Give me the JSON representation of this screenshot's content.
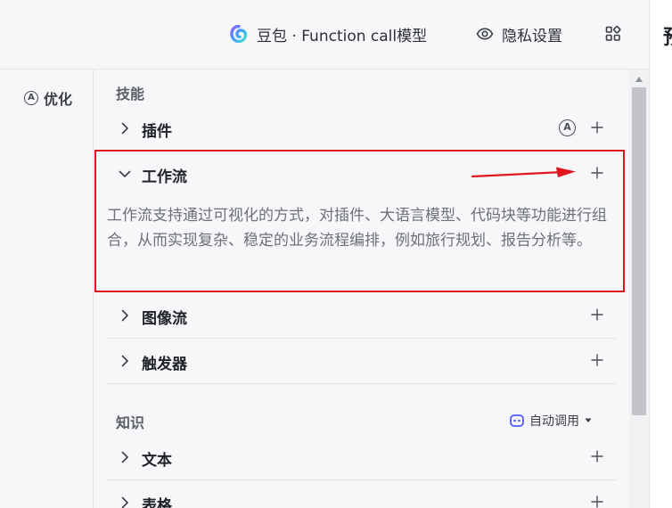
{
  "topbar": {
    "model_label": "豆包 · Function call模型",
    "privacy_label": "隐私设置",
    "right_edge_char": "预"
  },
  "leftcol": {
    "optimize_badge": "A",
    "optimize_label": "优化"
  },
  "skills": {
    "section_title": "技能",
    "items": [
      {
        "label": "插件",
        "badge": "A",
        "expanded": false
      },
      {
        "label": "工作流",
        "expanded": true,
        "description": "工作流支持通过可视化的方式，对插件、大语言模型、代码块等功能进行组合，从而实现复杂、稳定的业务流程编排，例如旅行规划、报告分析等。"
      },
      {
        "label": "图像流",
        "expanded": false
      },
      {
        "label": "触发器",
        "expanded": false
      }
    ]
  },
  "knowledge": {
    "section_title": "知识",
    "auto_call_label": "自动调用",
    "items": [
      {
        "label": "文本",
        "expanded": false
      },
      {
        "label": "表格",
        "expanded": false
      }
    ]
  },
  "colors": {
    "highlight_border": "#e0161c",
    "arrow": "#e0161c",
    "accent": "#4e5cf5"
  },
  "icons": {
    "logo": "doubao-logo-icon",
    "eye": "eye-icon",
    "grid": "apps-grid-icon",
    "chevron_right": "chevron-right-icon",
    "chevron_down": "chevron-down-icon",
    "plus": "plus-icon",
    "bot": "bot-icon",
    "caret": "caret-down-icon"
  }
}
